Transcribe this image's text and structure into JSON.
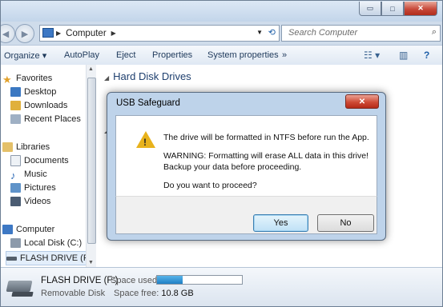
{
  "window": {
    "caption_buttons": {
      "minimize": "▭",
      "maximize": "□",
      "close": "✕"
    }
  },
  "address": {
    "location": "Computer",
    "search_placeholder": "Search Computer"
  },
  "toolbar": {
    "organize": "Organize ▾",
    "autoplay": "AutoPlay",
    "eject": "Eject",
    "properties": "Properties",
    "system_properties": "System properties",
    "more": "»"
  },
  "nav": {
    "favorites": "Favorites",
    "desktop": "Desktop",
    "downloads": "Downloads",
    "recent_places": "Recent Places",
    "libraries": "Libraries",
    "documents": "Documents",
    "music": "Music",
    "pictures": "Pictures",
    "videos": "Videos",
    "computer": "Computer",
    "local_disk": "Local Disk (C:)",
    "flash_drive": "FLASH DRIVE (F:)"
  },
  "content": {
    "group_hard_disk": "Hard Disk Drives"
  },
  "details": {
    "name": "FLASH DRIVE (F:)",
    "type": "Removable Disk",
    "space_used_label": "Space used:",
    "space_used_fraction": 0.3,
    "space_free_label": "Space free:",
    "space_free_value": "10.8 GB"
  },
  "dialog": {
    "title": "USB Safeguard",
    "close": "✕",
    "line1": "The drive will be formatted in NTFS before run the App.",
    "line2": "WARNING: Formatting will erase ALL data in this drive!",
    "line3": "Backup your data before proceeding.",
    "line4": "Do you want to proceed?",
    "yes": "Yes",
    "no": "No"
  },
  "colors": {
    "accent": "#1f7fc4",
    "warning": "#e8b21c",
    "close_red": "#cf4b36"
  }
}
